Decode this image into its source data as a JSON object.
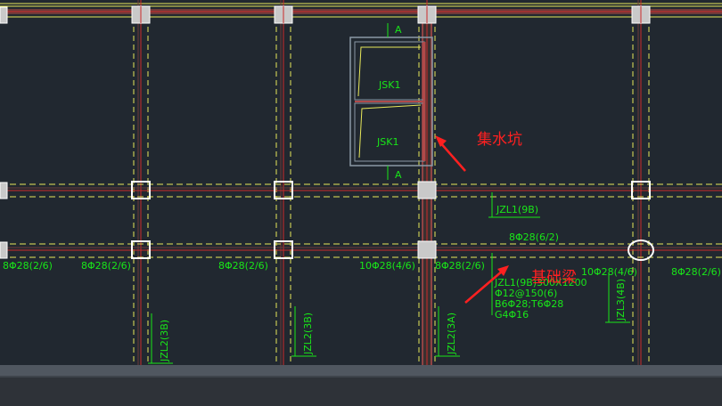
{
  "drawing": {
    "tank_label_top": "JSK1",
    "tank_label_bottom": "JSK1",
    "section_mark_top": "A",
    "section_mark_bottom": "A",
    "beam_tag_right": "JZL1(9B)",
    "rebar_top_mid": "8Φ28(6/2)",
    "rebar_labels_row": [
      "8Φ28(2/6)",
      "8Φ28(2/6)",
      "8Φ28(2/6)",
      "10Φ28(4/6)",
      "8Φ28(2/6)",
      "10Φ28(4/6)",
      "8Φ28(2/6)"
    ],
    "beam_note_lines": [
      "JZL1(9B)300X1200",
      "Φ12@150(6)",
      "B6Φ28;T6Φ28",
      "G4Φ16"
    ],
    "vertical_tags": [
      "JZL2(3B)",
      "JZL2(3B)",
      "JZL2(3A)",
      "JZL3(4B)"
    ]
  },
  "annotations": {
    "sump_pit": "集水坑",
    "foundation_beam": "基础梁"
  },
  "colors": {
    "background": "#212830",
    "grid_axis": "#cc2a2a",
    "dashed_beam": "#e8e85a",
    "label_green": "#19e619",
    "wall": "#b04a4a",
    "tank_outline": "#8a99a6",
    "annotation_red": "#ff2020"
  }
}
